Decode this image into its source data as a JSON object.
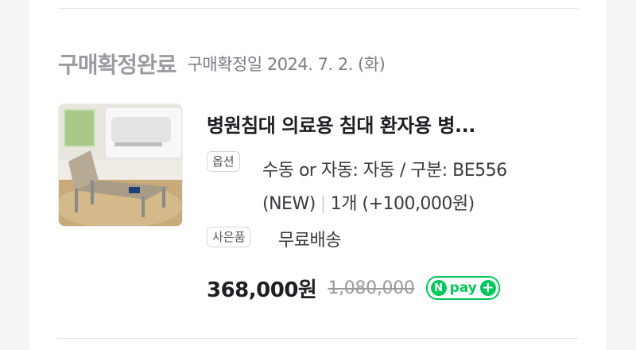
{
  "order": {
    "status_title": "구매확정완료",
    "confirm_date": "구매확정일 2024. 7. 2. (화)",
    "product_name": "병원침대 의료용 침대 환자용 병...",
    "option_tag": "옵션",
    "option_text": "수동 or 자동: 자동 / 구분: BE556 (NEW)",
    "quantity_text": "1개 (+100,000원)",
    "gift_tag": "사은품",
    "gift_text": "무료배송",
    "price": "368,000원",
    "original_price": "1,080,000",
    "payment": {
      "badge_letter": "N",
      "label": "pay",
      "plus": "+",
      "color": "#03c75a"
    }
  }
}
